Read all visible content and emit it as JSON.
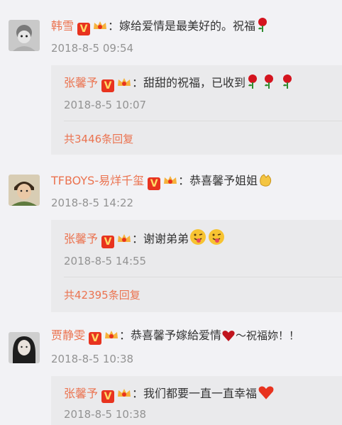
{
  "comments": [
    {
      "author": "韩雪",
      "text": "嫁给爱情是最美好的。祝福",
      "time": "2018-8-5 09:54",
      "reply": {
        "author": "张馨予",
        "text": "甜甜的祝福，已收到",
        "time": "2018-8-5 10:07"
      },
      "more": "共3446条回复"
    },
    {
      "author": "TFBOYS-易烊千玺",
      "text": "恭喜馨予姐姐",
      "time": "2018-8-5 14:22",
      "reply": {
        "author": "张馨予",
        "text": "谢谢弟弟",
        "time": "2018-8-5 14:55"
      },
      "more": "共42395条回复"
    },
    {
      "author": "贾静雯",
      "text": "恭喜馨予嫁給爱情",
      "text2": "～祝福妳！！",
      "time": "2018-8-5 10:38",
      "reply": {
        "author": "张馨予",
        "text": "我们都要一直一直幸福",
        "time": "2018-8-5 10:38"
      }
    }
  ],
  "badge": {
    "v_label": "V",
    "colon": "："
  },
  "colors": {
    "name": "#eb7350",
    "time": "#939393",
    "bg": "#f2f2f5",
    "reply_bg": "#eaeaec"
  }
}
